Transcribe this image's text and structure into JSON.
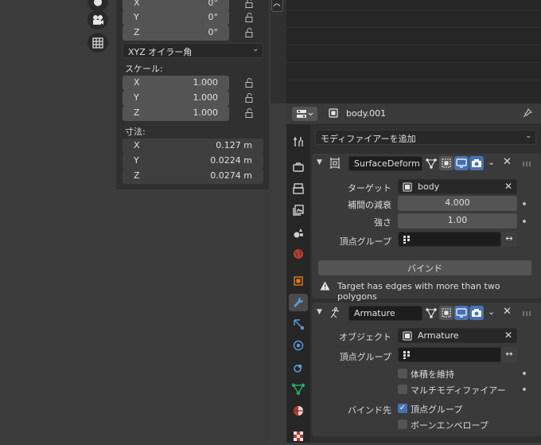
{
  "npanel": {
    "rotation": {
      "x": {
        "label": "X",
        "value": "0°"
      },
      "y": {
        "label": "Y",
        "value": "0°"
      },
      "z": {
        "label": "Z",
        "value": "0°"
      }
    },
    "rotation_mode": "XYZ オイラー角",
    "scale_label": "スケール:",
    "scale": {
      "x": {
        "label": "X",
        "value": "1.000"
      },
      "y": {
        "label": "Y",
        "value": "1.000"
      },
      "z": {
        "label": "Z",
        "value": "1.000"
      }
    },
    "dimensions_label": "寸法:",
    "dimensions": {
      "x": {
        "label": "X",
        "value": "0.127 m"
      },
      "y": {
        "label": "Y",
        "value": "0.0224 m"
      },
      "z": {
        "label": "Z",
        "value": "0.0274 m"
      }
    }
  },
  "props": {
    "object_name": "body.001",
    "add_modifier": "モディファイアーを追加",
    "surface_deform": {
      "name": "SurfaceDeform",
      "target_label": "ターゲット",
      "target_value": "body",
      "falloff_label": "補間の減衰",
      "falloff_value": "4.000",
      "strength_label": "強さ",
      "strength_value": "1.00",
      "vgroup_label": "頂点グループ",
      "bind_button": "バインド",
      "warning": "Target has edges with more than two polygons"
    },
    "armature": {
      "name": "Armature",
      "object_label": "オブジェクト",
      "object_value": "Armature",
      "vgroup_label": "頂点グループ",
      "preserve_volume": "体積を維持",
      "multi_modifier": "マルチモディファイアー",
      "bind_to_label": "バインド先",
      "bind_vgroups": "頂点グループ",
      "bind_envelopes": "ボーンエンベロープ"
    }
  },
  "colors": {
    "accent": "#4772b3",
    "panel": "#3a3a3a",
    "background": "#303030"
  }
}
